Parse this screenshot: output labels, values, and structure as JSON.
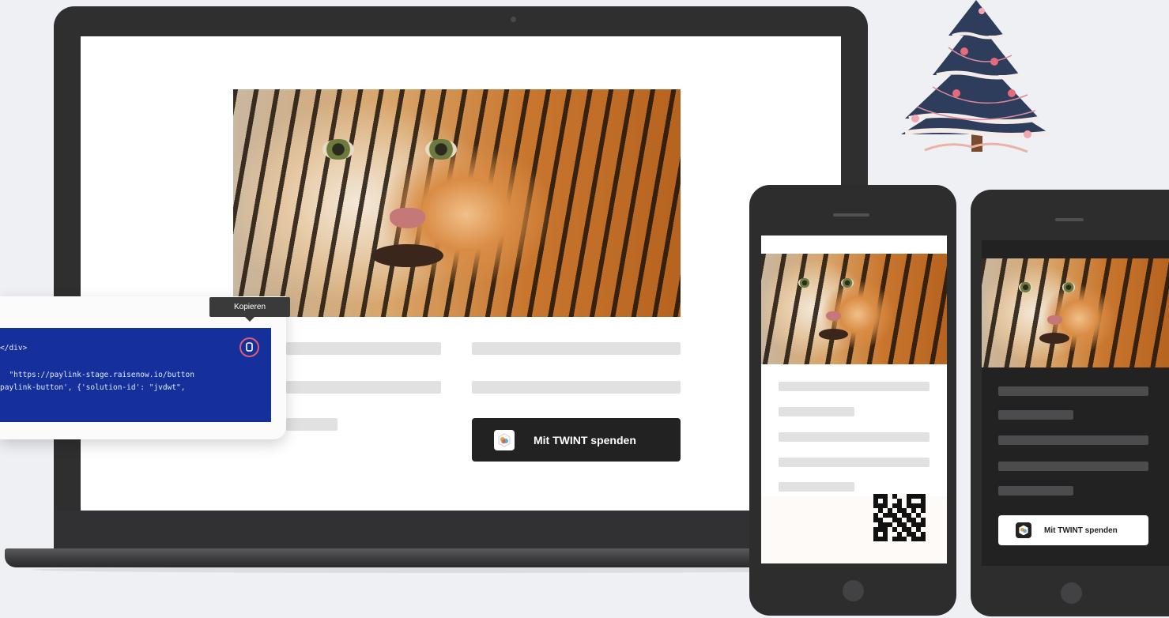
{
  "desktop": {
    "button_label": "Mit TWINT spenden"
  },
  "code_card": {
    "tooltip": "Kopieren",
    "code_lines": [
      "</div>",
      "",
      "  \"https://paylink-stage.raisenow.io/button",
      "paylink-button', {'solution-id': \"jvdwt\","
    ],
    "copy_icon": "copy-icon"
  },
  "phone_light": {
    "qr_icon": "qr-code-icon"
  },
  "phone_dark": {
    "button_label": "Mit TWINT spenden"
  },
  "decoration": {
    "tree_icon": "christmas-tree-icon"
  },
  "colors": {
    "code_background": "#15309a",
    "copy_ring": "#e05a7a",
    "button_dark": "#222222"
  }
}
